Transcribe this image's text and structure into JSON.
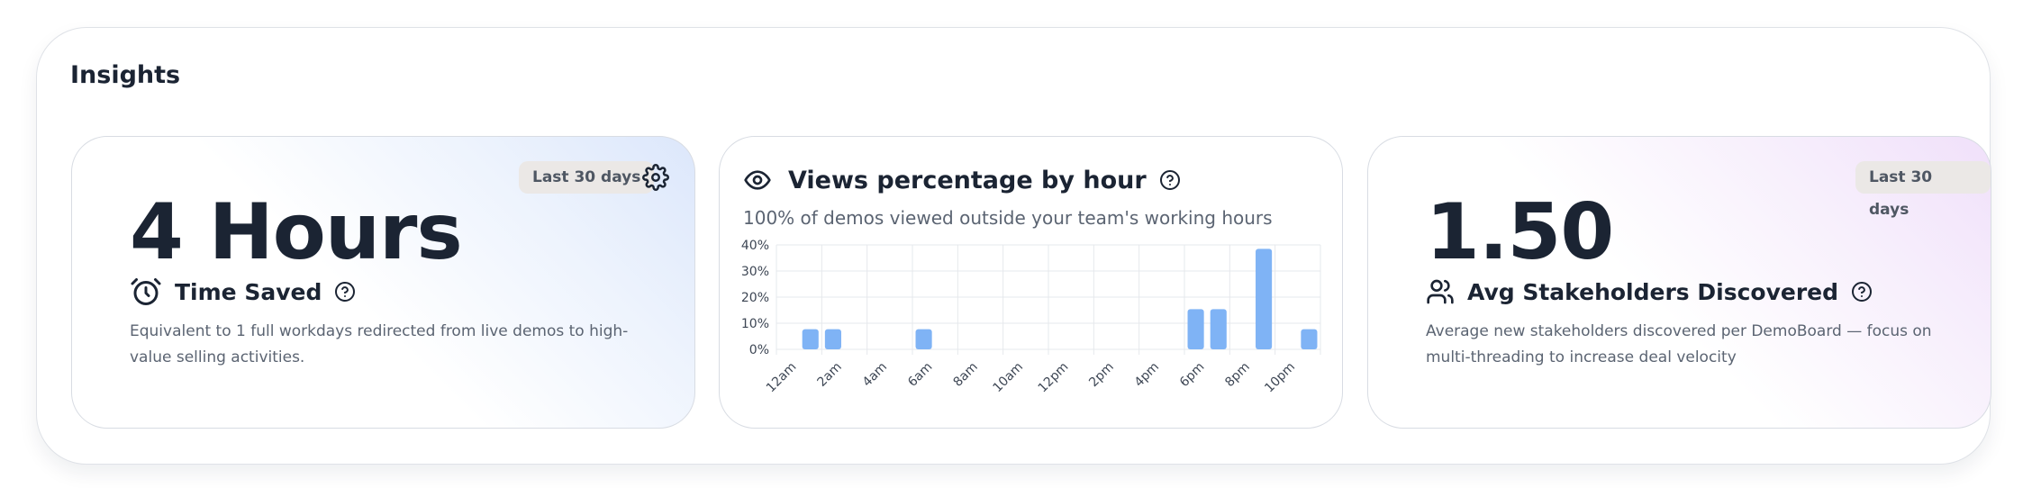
{
  "insights": {
    "title": "Insights",
    "time_saved": {
      "badge": "Last 30 days",
      "value": "4 Hours",
      "label": "Time Saved",
      "description": "Equivalent to 1 full workdays redirected from live demos to high-value selling activities.",
      "icons": [
        "settings-gear-icon",
        "alarm-clock-icon",
        "help-circle-icon"
      ]
    },
    "views_by_hour": {
      "title": "Views percentage by hour",
      "subtitle": "100% of demos viewed outside your team's working hours",
      "icons": [
        "eye-icon",
        "help-circle-icon"
      ]
    },
    "stakeholders": {
      "badge": "Last 30 days",
      "value": "1.50",
      "label": "Avg Stakeholders Discovered",
      "description": "Average new stakeholders discovered per DemoBoard — focus on multi-threading to increase deal velocity",
      "icons": [
        "users-icon",
        "help-circle-icon"
      ]
    }
  },
  "colors": {
    "text_primary": "#1b2433",
    "text_secondary": "#5b6472",
    "bar": "#7fb3f5",
    "badge_bg": "#ebe8e6"
  },
  "chart_data": {
    "type": "bar",
    "categories": [
      "12am",
      "1am",
      "2am",
      "3am",
      "4am",
      "5am",
      "6am",
      "7am",
      "8am",
      "9am",
      "10am",
      "11am",
      "12pm",
      "1pm",
      "2pm",
      "3pm",
      "4pm",
      "5pm",
      "6pm",
      "7pm",
      "8pm",
      "9pm",
      "10pm",
      "11pm"
    ],
    "values": [
      0,
      7.7,
      7.7,
      0,
      0,
      0,
      7.7,
      0,
      0,
      0,
      0,
      0,
      0,
      0,
      0,
      0,
      0,
      0,
      15.4,
      15.4,
      0,
      38.5,
      0,
      7.7
    ],
    "tick_labels": [
      "12am",
      "2am",
      "4am",
      "6am",
      "8am",
      "10am",
      "12pm",
      "2pm",
      "4pm",
      "6pm",
      "8pm",
      "10pm"
    ],
    "y_ticks": [
      "0%",
      "10%",
      "20%",
      "30%",
      "40%"
    ],
    "ylim": [
      0,
      40
    ],
    "grid": true,
    "legend": "none"
  }
}
